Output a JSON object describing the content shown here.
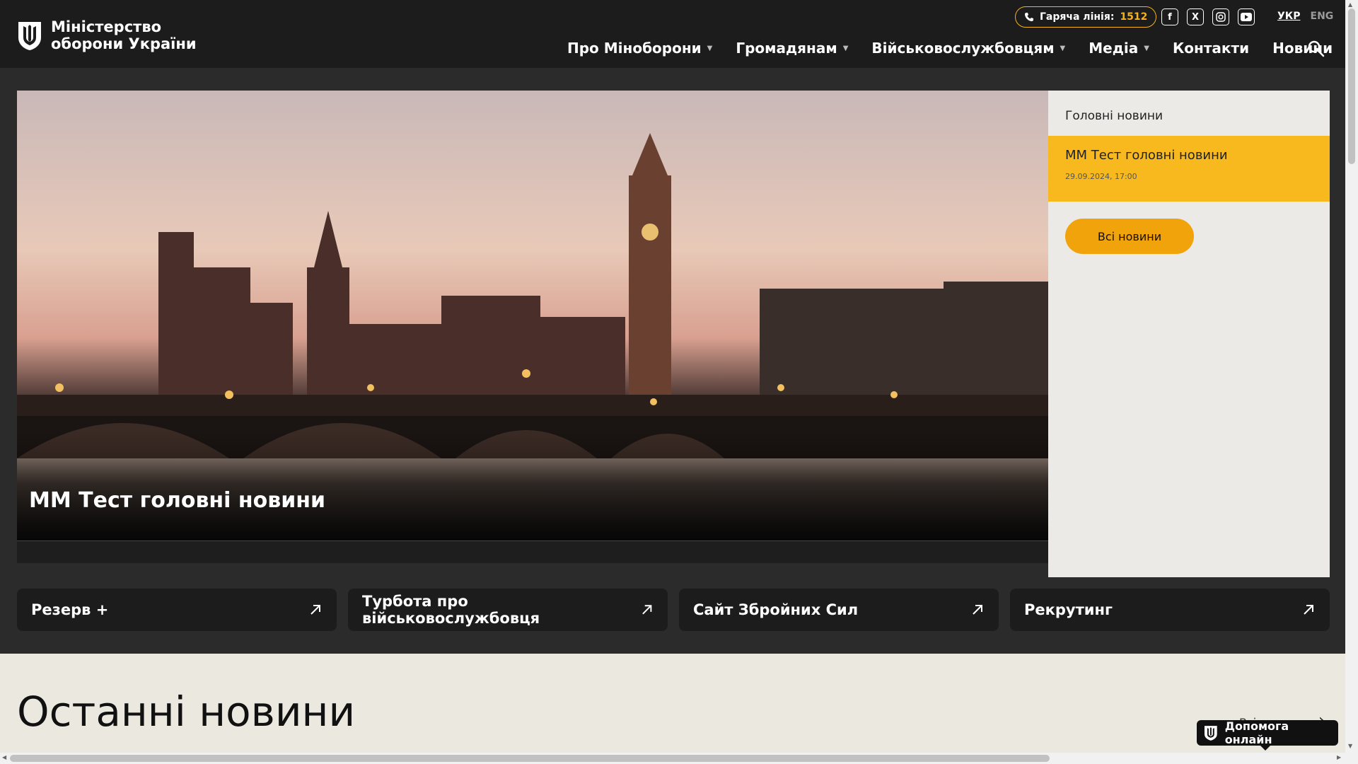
{
  "header": {
    "logo_line1": "Міністерство",
    "logo_line2": "оборони України",
    "hotline_label": "Гаряча лінія:",
    "hotline_number": "1512",
    "socials": [
      "facebook-icon",
      "x-icon",
      "instagram-icon",
      "youtube-icon"
    ],
    "lang_active": "УКР",
    "lang_other": "ENG",
    "nav": [
      {
        "label": "Про Міноборони",
        "dropdown": true
      },
      {
        "label": "Громадянам",
        "dropdown": true
      },
      {
        "label": "Військовослужбовцям",
        "dropdown": true
      },
      {
        "label": "Медіа",
        "dropdown": true
      },
      {
        "label": "Контакти",
        "dropdown": false
      },
      {
        "label": "Новини",
        "dropdown": false
      }
    ]
  },
  "hero": {
    "title": "ММ Тест головні новини"
  },
  "sidebar": {
    "title": "Головні новини",
    "item_title": "ММ Тест головні новини",
    "item_date": "29.09.2024, 17:00",
    "all_news": "Всі новини"
  },
  "quick_links": [
    {
      "label": "Резерв +"
    },
    {
      "label": "Турбота про військовослужбовця"
    },
    {
      "label": "Сайт Збройних Сил"
    },
    {
      "label": "Рекрутинг"
    }
  ],
  "latest": {
    "title": "Останні новини",
    "all_link": "Всі новини"
  },
  "help": {
    "label": "Допомога онлайн"
  },
  "colors": {
    "accent": "#f5b21b",
    "button": "#f0a30a",
    "header_bg": "#1c1c1c"
  }
}
